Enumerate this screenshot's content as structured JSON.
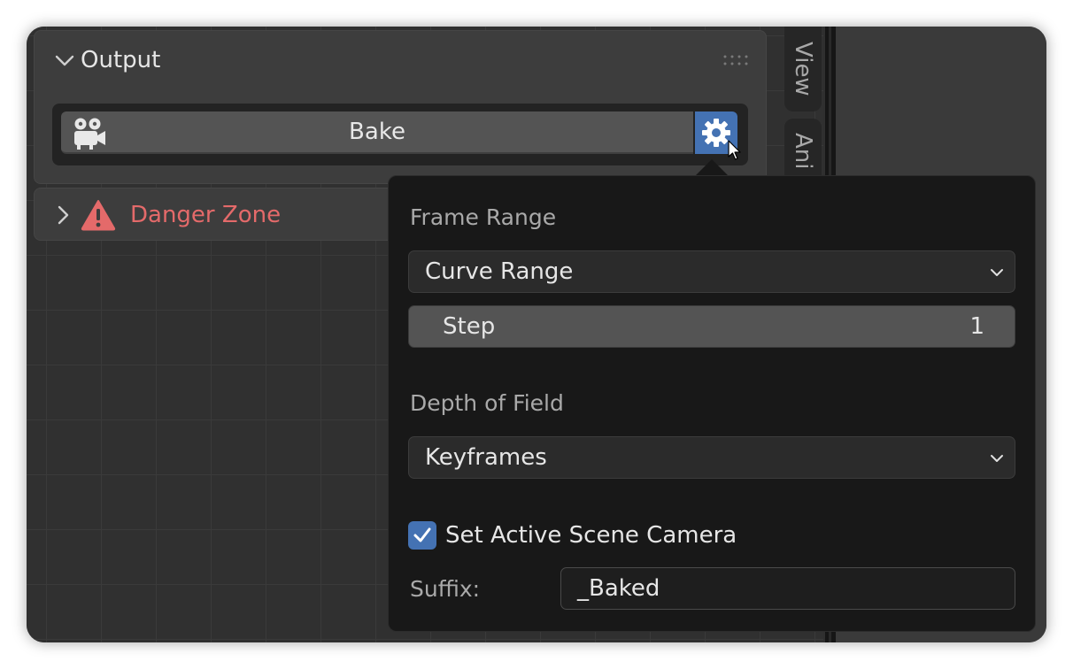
{
  "output_panel": {
    "title": "Output",
    "bake_label": "Bake"
  },
  "danger_panel": {
    "title": "Danger Zone"
  },
  "side_tabs": [
    {
      "label": "View"
    },
    {
      "label": "Ani"
    }
  ],
  "popup": {
    "frame_range_label": "Frame Range",
    "frame_range_value": "Curve Range",
    "step_label": "Step",
    "step_value": "1",
    "dof_label": "Depth of Field",
    "dof_value": "Keyframes",
    "set_camera_label": "Set Active Scene Camera",
    "set_camera_checked": true,
    "suffix_label": "Suffix:",
    "suffix_value": "_Baked"
  },
  "colors": {
    "accent": "#4472b3",
    "danger": "#e46a6a",
    "popup_bg": "#181818",
    "panel_bg": "#3d3d3d"
  },
  "icons": {
    "output_chevron": "chevron-down-icon",
    "danger_chevron": "chevron-right-icon",
    "camera": "camera-icon",
    "gear": "gear-icon",
    "warning": "warning-icon",
    "checkbox": "checkmark-icon"
  }
}
